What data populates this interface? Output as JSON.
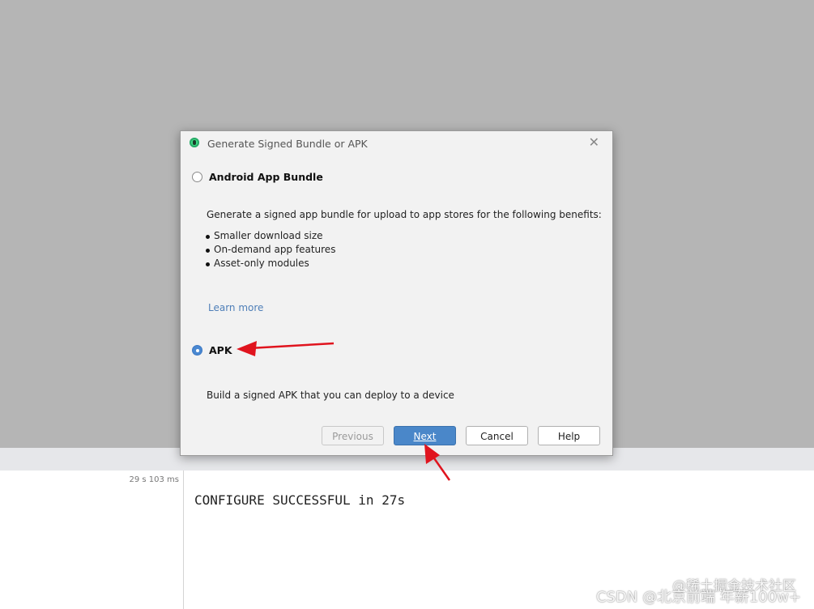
{
  "dialog": {
    "title": "Generate Signed Bundle or APK",
    "close_glyph": "✕",
    "options": [
      {
        "label": "Android App Bundle",
        "selected": false,
        "description": "Generate a signed app bundle for upload to app stores for the following benefits:",
        "benefits": [
          "Smaller download size",
          "On-demand app features",
          "Asset-only modules"
        ],
        "link": "Learn more"
      },
      {
        "label": "APK",
        "selected": true,
        "description": "Build a signed APK that you can deploy to a device"
      }
    ],
    "buttons": {
      "previous": "Previous",
      "next": "Next",
      "cancel": "Cancel",
      "help": "Help"
    }
  },
  "build": {
    "duration": "29 s 103 ms",
    "console_output": "CONFIGURE SUCCESSFUL in 27s"
  },
  "watermarks": [
    "@稀土掘金技术社区",
    "CSDN @北京前端 年薪100w+"
  ],
  "colors": {
    "accent": "#4a87c9",
    "annotation_arrow": "#e0141e",
    "link": "#4f7fb8"
  },
  "icons": {
    "app": "android-studio-icon",
    "close": "close-icon"
  }
}
